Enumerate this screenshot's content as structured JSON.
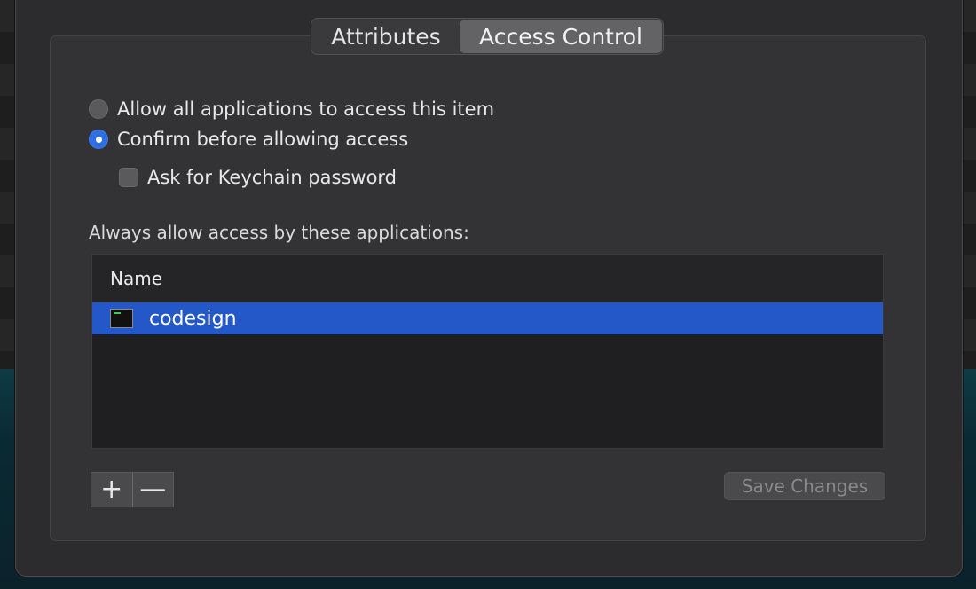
{
  "tabs": [
    {
      "label": "Attributes",
      "selected": false
    },
    {
      "label": "Access Control",
      "selected": true
    }
  ],
  "access_options": {
    "allow_all_label": "Allow all applications to access this item",
    "allow_all_selected": false,
    "confirm_label": "Confirm before allowing access",
    "confirm_selected": true,
    "ask_password_label": "Ask for Keychain password",
    "ask_password_checked": false
  },
  "apps_section": {
    "label": "Always allow access by these applications:",
    "column_header": "Name",
    "rows": [
      {
        "name": "codesign",
        "icon": "terminal-icon",
        "selected": true
      }
    ]
  },
  "controls": {
    "add_label": "+",
    "remove_label": "—",
    "save_label": "Save Changes",
    "save_enabled": false
  },
  "colors": {
    "selection": "#2458c8",
    "radio_on": "#2f6fe0"
  }
}
